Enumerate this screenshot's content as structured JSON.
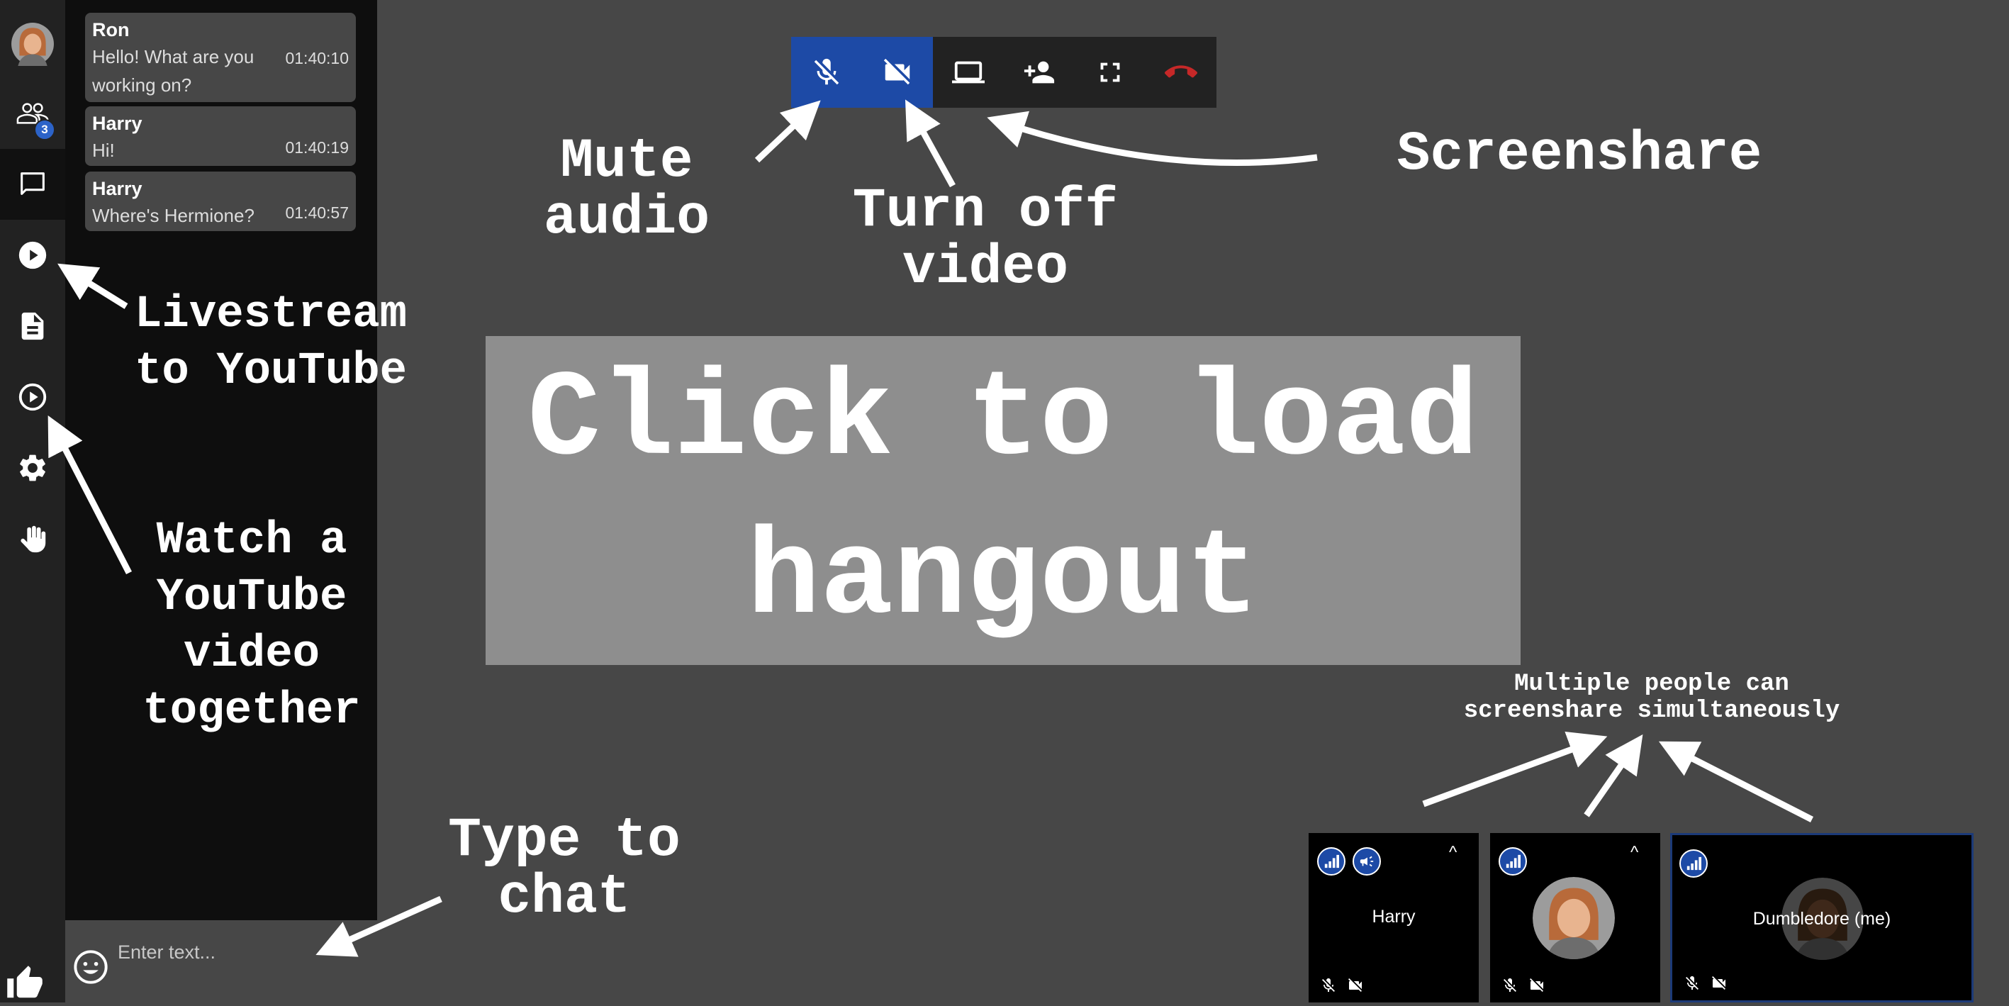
{
  "chat": {
    "messages": [
      {
        "author": "Ron",
        "text": "Hello! What are you working on?",
        "time": "01:40:10"
      },
      {
        "author": "Harry",
        "text": "Hi!",
        "time": "01:40:19"
      },
      {
        "author": "Harry",
        "text": "Where's Hermione?",
        "time": "01:40:57"
      }
    ],
    "input_placeholder": "Enter text..."
  },
  "sidebar": {
    "participant_count": "3"
  },
  "hangout": {
    "overlay_text": "Click to load hangout"
  },
  "annotations": {
    "mute_audio": "Mute audio",
    "turn_off_video": "Turn off video",
    "screenshare": "Screenshare",
    "livestream": "Livestream to YouTube",
    "watch_youtube": "Watch a YouTube video together",
    "type_to_chat": "Type to chat",
    "multiple_screenshare": "Multiple people can screenshare simultaneously"
  },
  "tiles": [
    {
      "name": "Harry"
    },
    {
      "name": ""
    },
    {
      "name": "Dumbledore (me)"
    }
  ],
  "colors": {
    "accent_blue": "#1d4aa6",
    "hangup_red": "#c62828",
    "background": "#474747",
    "chat_bg": "#0e0e0e",
    "rail_bg": "#222222"
  },
  "icons": {
    "rail": [
      "avatar",
      "people-icon",
      "chat-icon",
      "livestream-icon",
      "document-icon",
      "youtube-play-icon",
      "gear-icon",
      "raise-hand-icon"
    ],
    "toolbar": [
      "mic-off-icon",
      "video-off-icon",
      "screenshare-icon",
      "add-person-icon",
      "fullscreen-icon",
      "hangup-icon"
    ]
  }
}
